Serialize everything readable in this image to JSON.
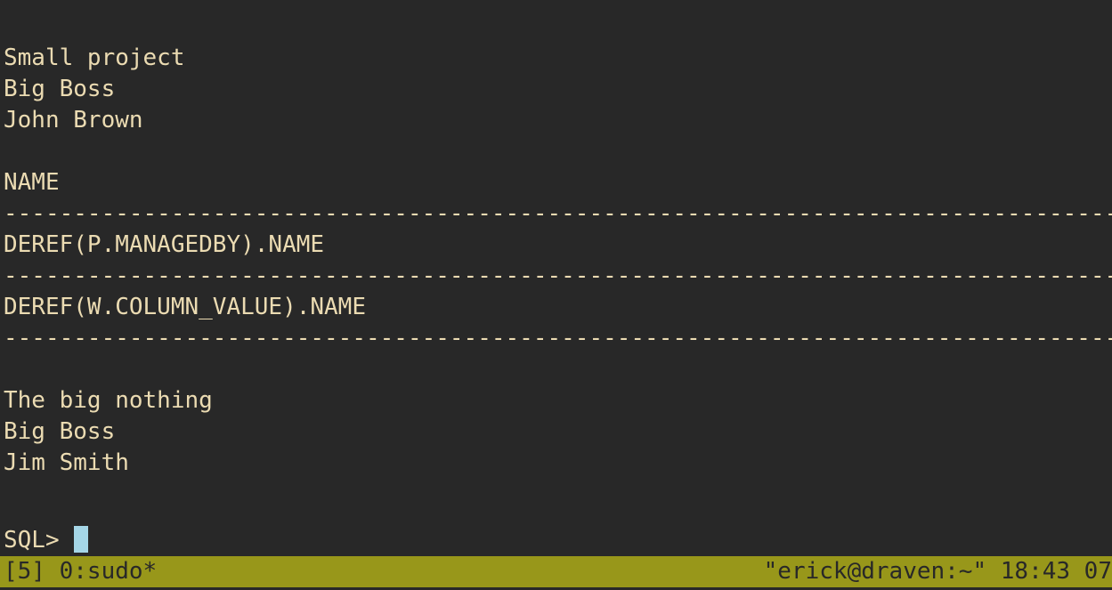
{
  "terminal": {
    "output_lines": [
      "",
      "Small project",
      "Big Boss",
      "John Brown",
      "",
      "NAME",
      "----------------------------------------------------------------------------------------------------",
      "DEREF(P.MANAGEDBY).NAME",
      "----------------------------------------------------------------------------------------------------",
      "DEREF(W.COLUMN_VALUE).NAME",
      "----------------------------------------------------------------------------------------------------",
      "",
      "The big nothing",
      "Big Boss",
      "Jim Smith"
    ],
    "prompt": "SQL>"
  },
  "status_bar": {
    "session": "[5] 0:sudo*",
    "host": "\"erick@draven:~\" 18:43 07"
  },
  "colors": {
    "background": "#282828",
    "foreground": "#ebdbb2",
    "status_bar": "#98971a",
    "cursor": "#a5d6e6"
  }
}
